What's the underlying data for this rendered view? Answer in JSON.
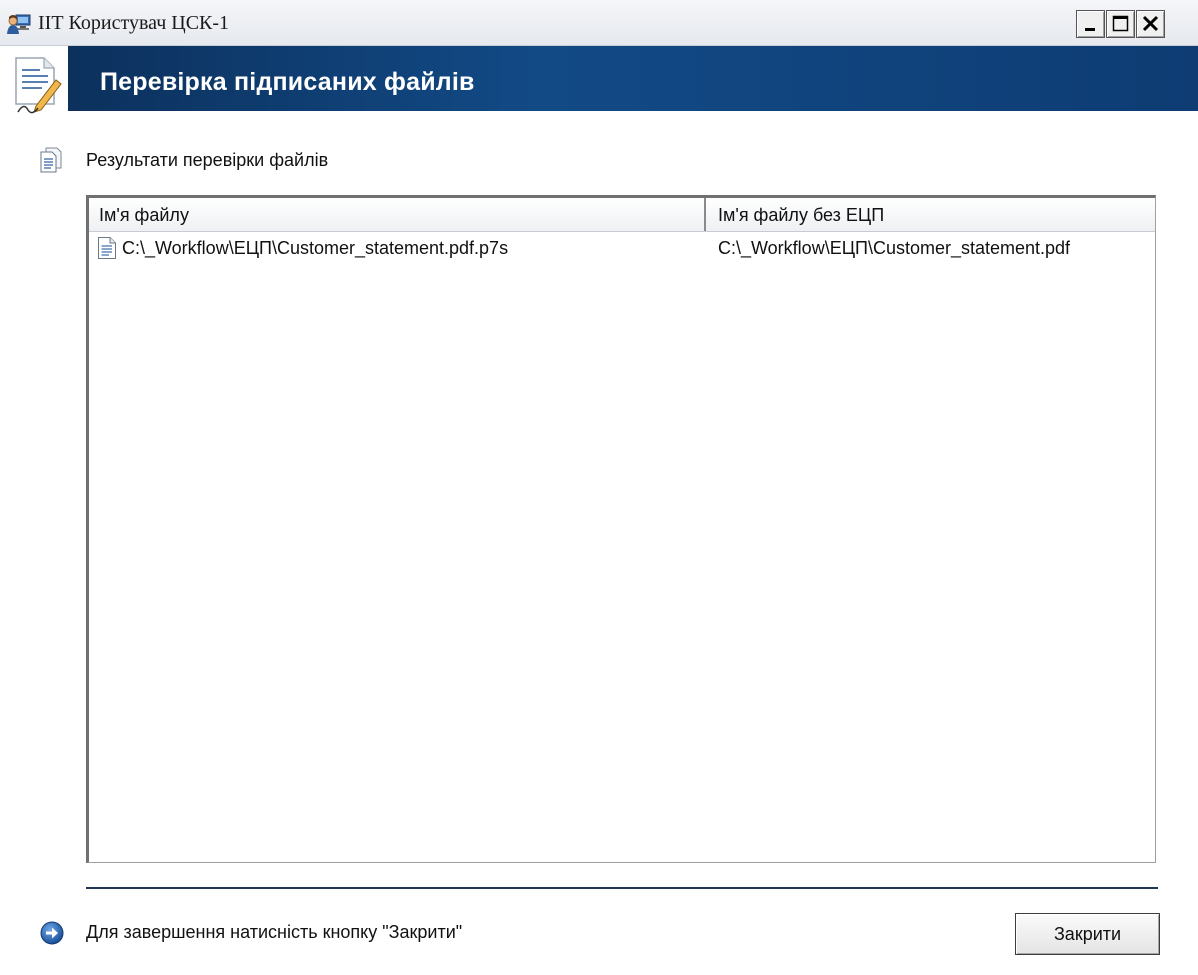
{
  "window": {
    "title": "ІІТ Користувач ЦСК-1",
    "app_icon": "computer-user-icon",
    "controls": {
      "minimize_icon": "minimize-icon",
      "maximize_icon": "maximize-icon",
      "close_icon": "close-icon"
    }
  },
  "banner": {
    "title": "Перевірка підписаних файлів",
    "icon": "document-sign-icon",
    "gradient_colors": [
      "#0b2d57",
      "#124a86",
      "#0e3c73"
    ]
  },
  "section": {
    "label": "Результати перевірки файлів",
    "icon": "documents-icon"
  },
  "list": {
    "columns": [
      {
        "label": "Ім'я файлу"
      },
      {
        "label": "Ім'я файлу без ЕЦП"
      }
    ],
    "rows": [
      {
        "icon": "file-icon",
        "file_name": "C:\\_Workflow\\ЕЦП\\Customer_statement.pdf.p7s",
        "file_name_without_signature": "C:\\_Workflow\\ЕЦП\\Customer_statement.pdf"
      }
    ]
  },
  "footer": {
    "hint": "Для завершення натисність кнопку \"Закрити\"",
    "hint_icon": "arrow-right-circle-icon",
    "close_label": "Закрити"
  }
}
